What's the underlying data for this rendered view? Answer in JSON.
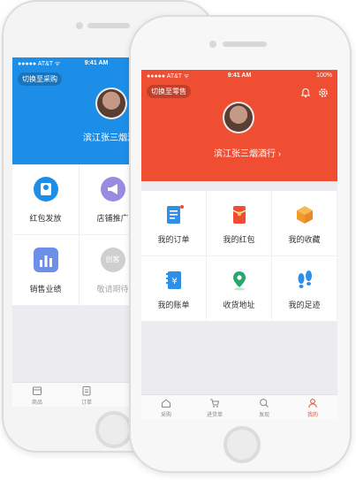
{
  "back_phone": {
    "status": {
      "carrier": "●●●●● AT&T ᯤ",
      "time": "9:41 AM"
    },
    "switch_label": "切换至采购",
    "shop_name": "滨江张三烟酒",
    "grid": [
      {
        "label": "红包发放",
        "icon": "red-packet-send-icon"
      },
      {
        "label": "店铺推广",
        "icon": "megaphone-icon"
      },
      {
        "label": "销售业绩",
        "icon": "bar-chart-icon"
      },
      {
        "label": "敬请期待",
        "badge": "创客",
        "icon": "coming-soon-icon"
      }
    ],
    "tabs": [
      {
        "label": "商品",
        "icon": "goods-icon"
      },
      {
        "label": "订单",
        "icon": "order-icon"
      }
    ],
    "colors": {
      "header": "#1d8ee8"
    }
  },
  "front_phone": {
    "status": {
      "carrier": "●●●●● AT&T ᯤ",
      "time": "9:41 AM",
      "battery": "100%"
    },
    "switch_label": "切换至零售",
    "shop_name": "滨江张三烟酒行",
    "grid": [
      {
        "label": "我的订单",
        "icon": "order-list-icon"
      },
      {
        "label": "我的红包",
        "icon": "red-packet-icon"
      },
      {
        "label": "我的收藏",
        "icon": "favorite-box-icon"
      },
      {
        "label": "我的账单",
        "icon": "bill-icon"
      },
      {
        "label": "收货地址",
        "icon": "location-icon"
      },
      {
        "label": "我的足迹",
        "icon": "footprint-icon"
      }
    ],
    "tabs": [
      {
        "label": "采购",
        "icon": "home-icon"
      },
      {
        "label": "进货单",
        "icon": "cart-icon"
      },
      {
        "label": "发现",
        "icon": "discover-icon"
      },
      {
        "label": "我的",
        "icon": "profile-icon",
        "active": true
      }
    ],
    "colors": {
      "header": "#ef4e32",
      "accent": "#ef4e32"
    }
  }
}
